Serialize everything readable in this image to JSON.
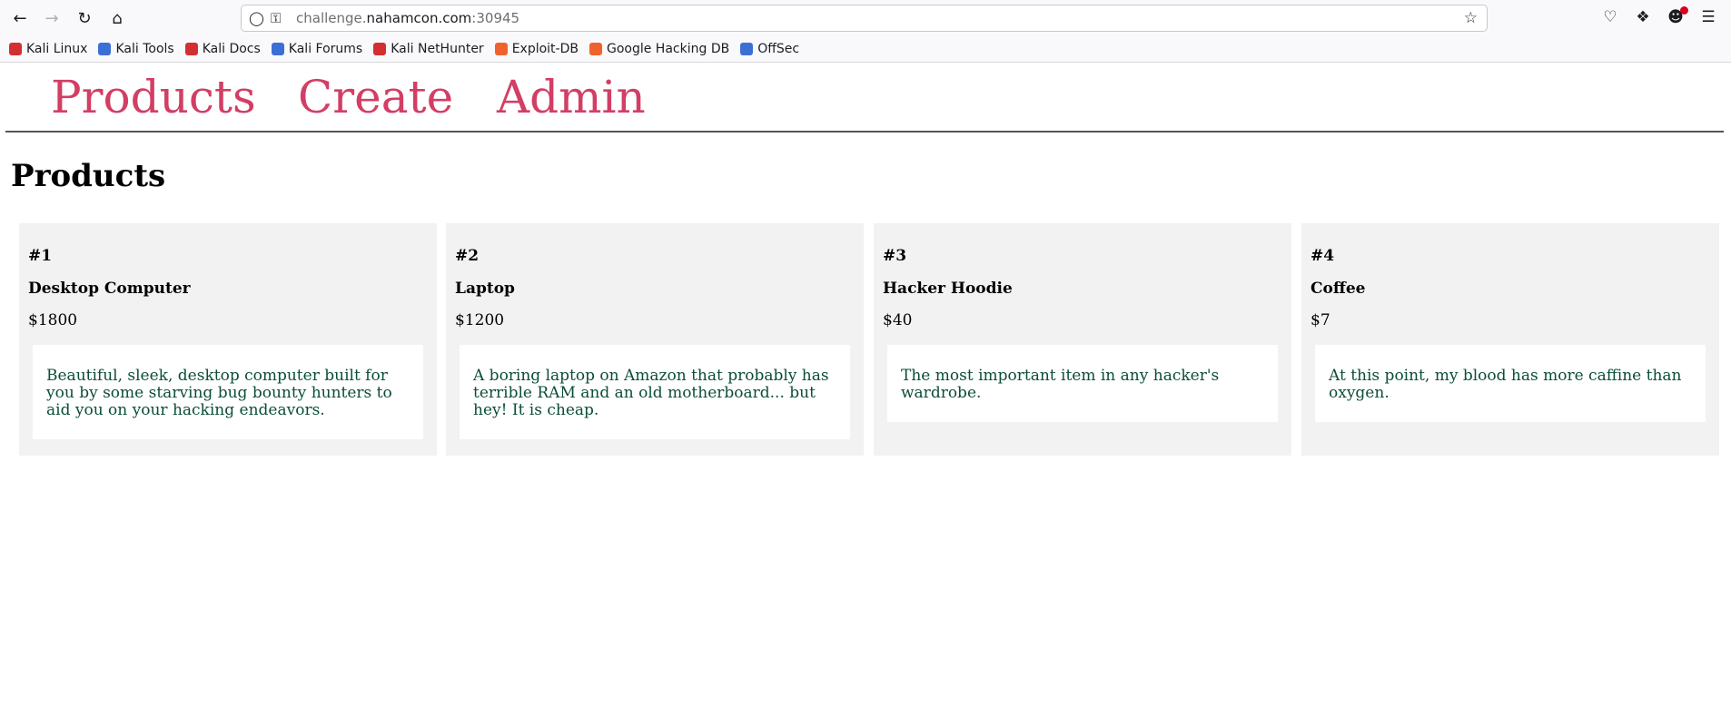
{
  "browser": {
    "url_prefix": "challenge.",
    "url_host": "nahamcon.com",
    "url_port": ":30945",
    "bookmarks": [
      {
        "label": "Kali Linux",
        "icon": "kali-icon",
        "color": "#d32f2f"
      },
      {
        "label": "Kali Tools",
        "icon": "kali-tools-icon",
        "color": "#3b6fd6"
      },
      {
        "label": "Kali Docs",
        "icon": "kali-docs-icon",
        "color": "#d32f2f"
      },
      {
        "label": "Kali Forums",
        "icon": "kali-forums-icon",
        "color": "#3b6fd6"
      },
      {
        "label": "Kali NetHunter",
        "icon": "kali-nethunter-icon",
        "color": "#d32f2f"
      },
      {
        "label": "Exploit-DB",
        "icon": "exploit-db-icon",
        "color": "#f0622d"
      },
      {
        "label": "Google Hacking DB",
        "icon": "ghdb-icon",
        "color": "#f0622d"
      },
      {
        "label": "OffSec",
        "icon": "offsec-icon",
        "color": "#3b6fd6"
      }
    ]
  },
  "nav": {
    "products": "Products",
    "create": "Create",
    "admin": "Admin"
  },
  "page": {
    "title": "Products"
  },
  "products": [
    {
      "id": "#1",
      "name": "Desktop Computer",
      "price": "$1800",
      "description": "Beautiful, sleek, desktop computer built for you by some starving bug bounty hunters to aid you on your hacking endeavors."
    },
    {
      "id": "#2",
      "name": "Laptop",
      "price": "$1200",
      "description": "A boring laptop on Amazon that probably has terrible RAM and an old motherboard... but hey! It is cheap."
    },
    {
      "id": "#3",
      "name": "Hacker Hoodie",
      "price": "$40",
      "description": "The most important item in any hacker's wardrobe."
    },
    {
      "id": "#4",
      "name": "Coffee",
      "price": "$7",
      "description": "At this point, my blood has more caffine than oxygen."
    }
  ],
  "colors": {
    "nav_link": "#d23e64",
    "description_text": "#0b4d3a",
    "card_bg": "#f2f2f2"
  }
}
